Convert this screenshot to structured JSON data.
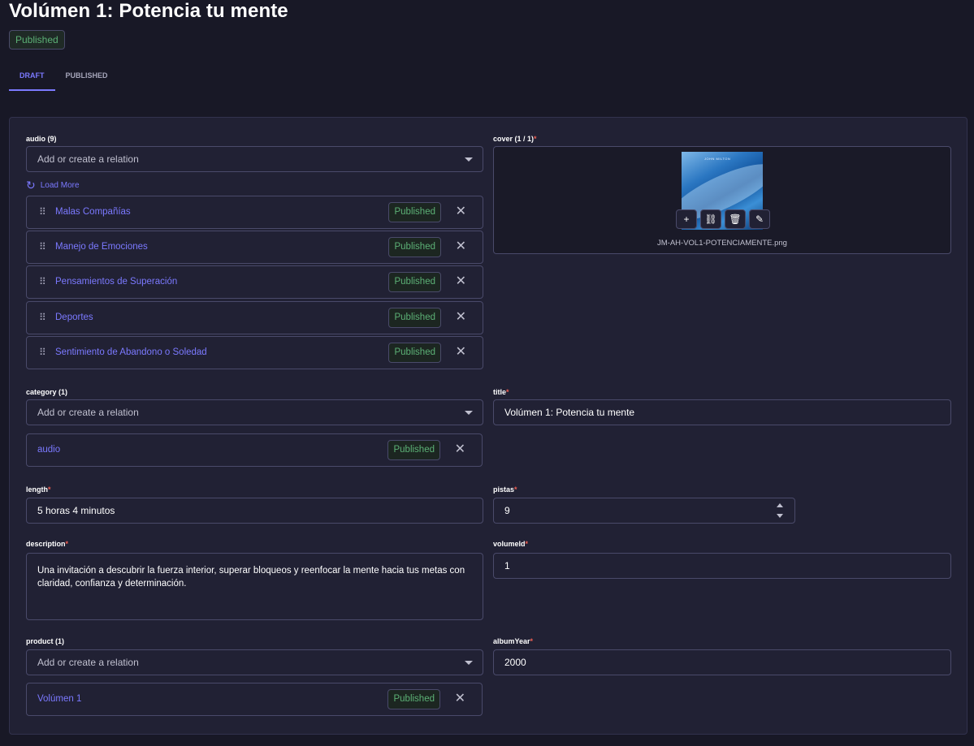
{
  "header": {
    "title": "Volúmen 1: Potencia tu mente",
    "status": "Published"
  },
  "tabs": [
    {
      "label": "DRAFT",
      "active": true
    },
    {
      "label": "PUBLISHED",
      "active": false
    }
  ],
  "audio": {
    "label": "audio (9)",
    "placeholder": "Add or create a relation",
    "load_more": "Load More",
    "items": [
      {
        "name": "Malas Compañías",
        "status": "Published"
      },
      {
        "name": "Manejo de Emociones",
        "status": "Published"
      },
      {
        "name": "Pensamientos de Superación",
        "status": "Published"
      },
      {
        "name": "Deportes",
        "status": "Published"
      },
      {
        "name": "Sentimiento de Abandono o Soledad",
        "status": "Published"
      }
    ]
  },
  "cover": {
    "label": "cover (1 / 1)",
    "required": "*",
    "filename": "JM-AH-VOL1-POTENCIAMENTE.png",
    "image_text": "JOHN MILTON",
    "actions": [
      "+",
      "⛓",
      "🗑",
      "✎"
    ]
  },
  "category": {
    "label": "category (1)",
    "placeholder": "Add or create a relation",
    "items": [
      {
        "name": "audio",
        "status": "Published"
      }
    ]
  },
  "title_field": {
    "label": "title",
    "required": "*",
    "value": "Volúmen 1: Potencia tu mente"
  },
  "length_field": {
    "label": "length",
    "required": "*",
    "value": "5 horas 4 minutos"
  },
  "pistas_field": {
    "label": "pistas",
    "required": "*",
    "value": "9"
  },
  "description_field": {
    "label": "description",
    "required": "*",
    "value": "Una invitación a descubrir la fuerza interior, superar bloqueos y reenfocar la mente hacia tus metas con claridad, confianza y determinación."
  },
  "volumeId_field": {
    "label": "volumeId",
    "required": "*",
    "value": "1"
  },
  "product": {
    "label": "product (1)",
    "placeholder": "Add or create a relation",
    "items": [
      {
        "name": "Volúmen 1",
        "status": "Published"
      }
    ]
  },
  "albumYear_field": {
    "label": "albumYear",
    "required": "*",
    "value": "2000"
  },
  "icons": {
    "remove": "✕",
    "drag": "⠿",
    "refresh": "↻"
  },
  "colors": {
    "accent": "#7b79ff",
    "published_green": "#5cb176",
    "required_red": "#ee5e52",
    "background": "#181826",
    "panel": "#212134"
  }
}
